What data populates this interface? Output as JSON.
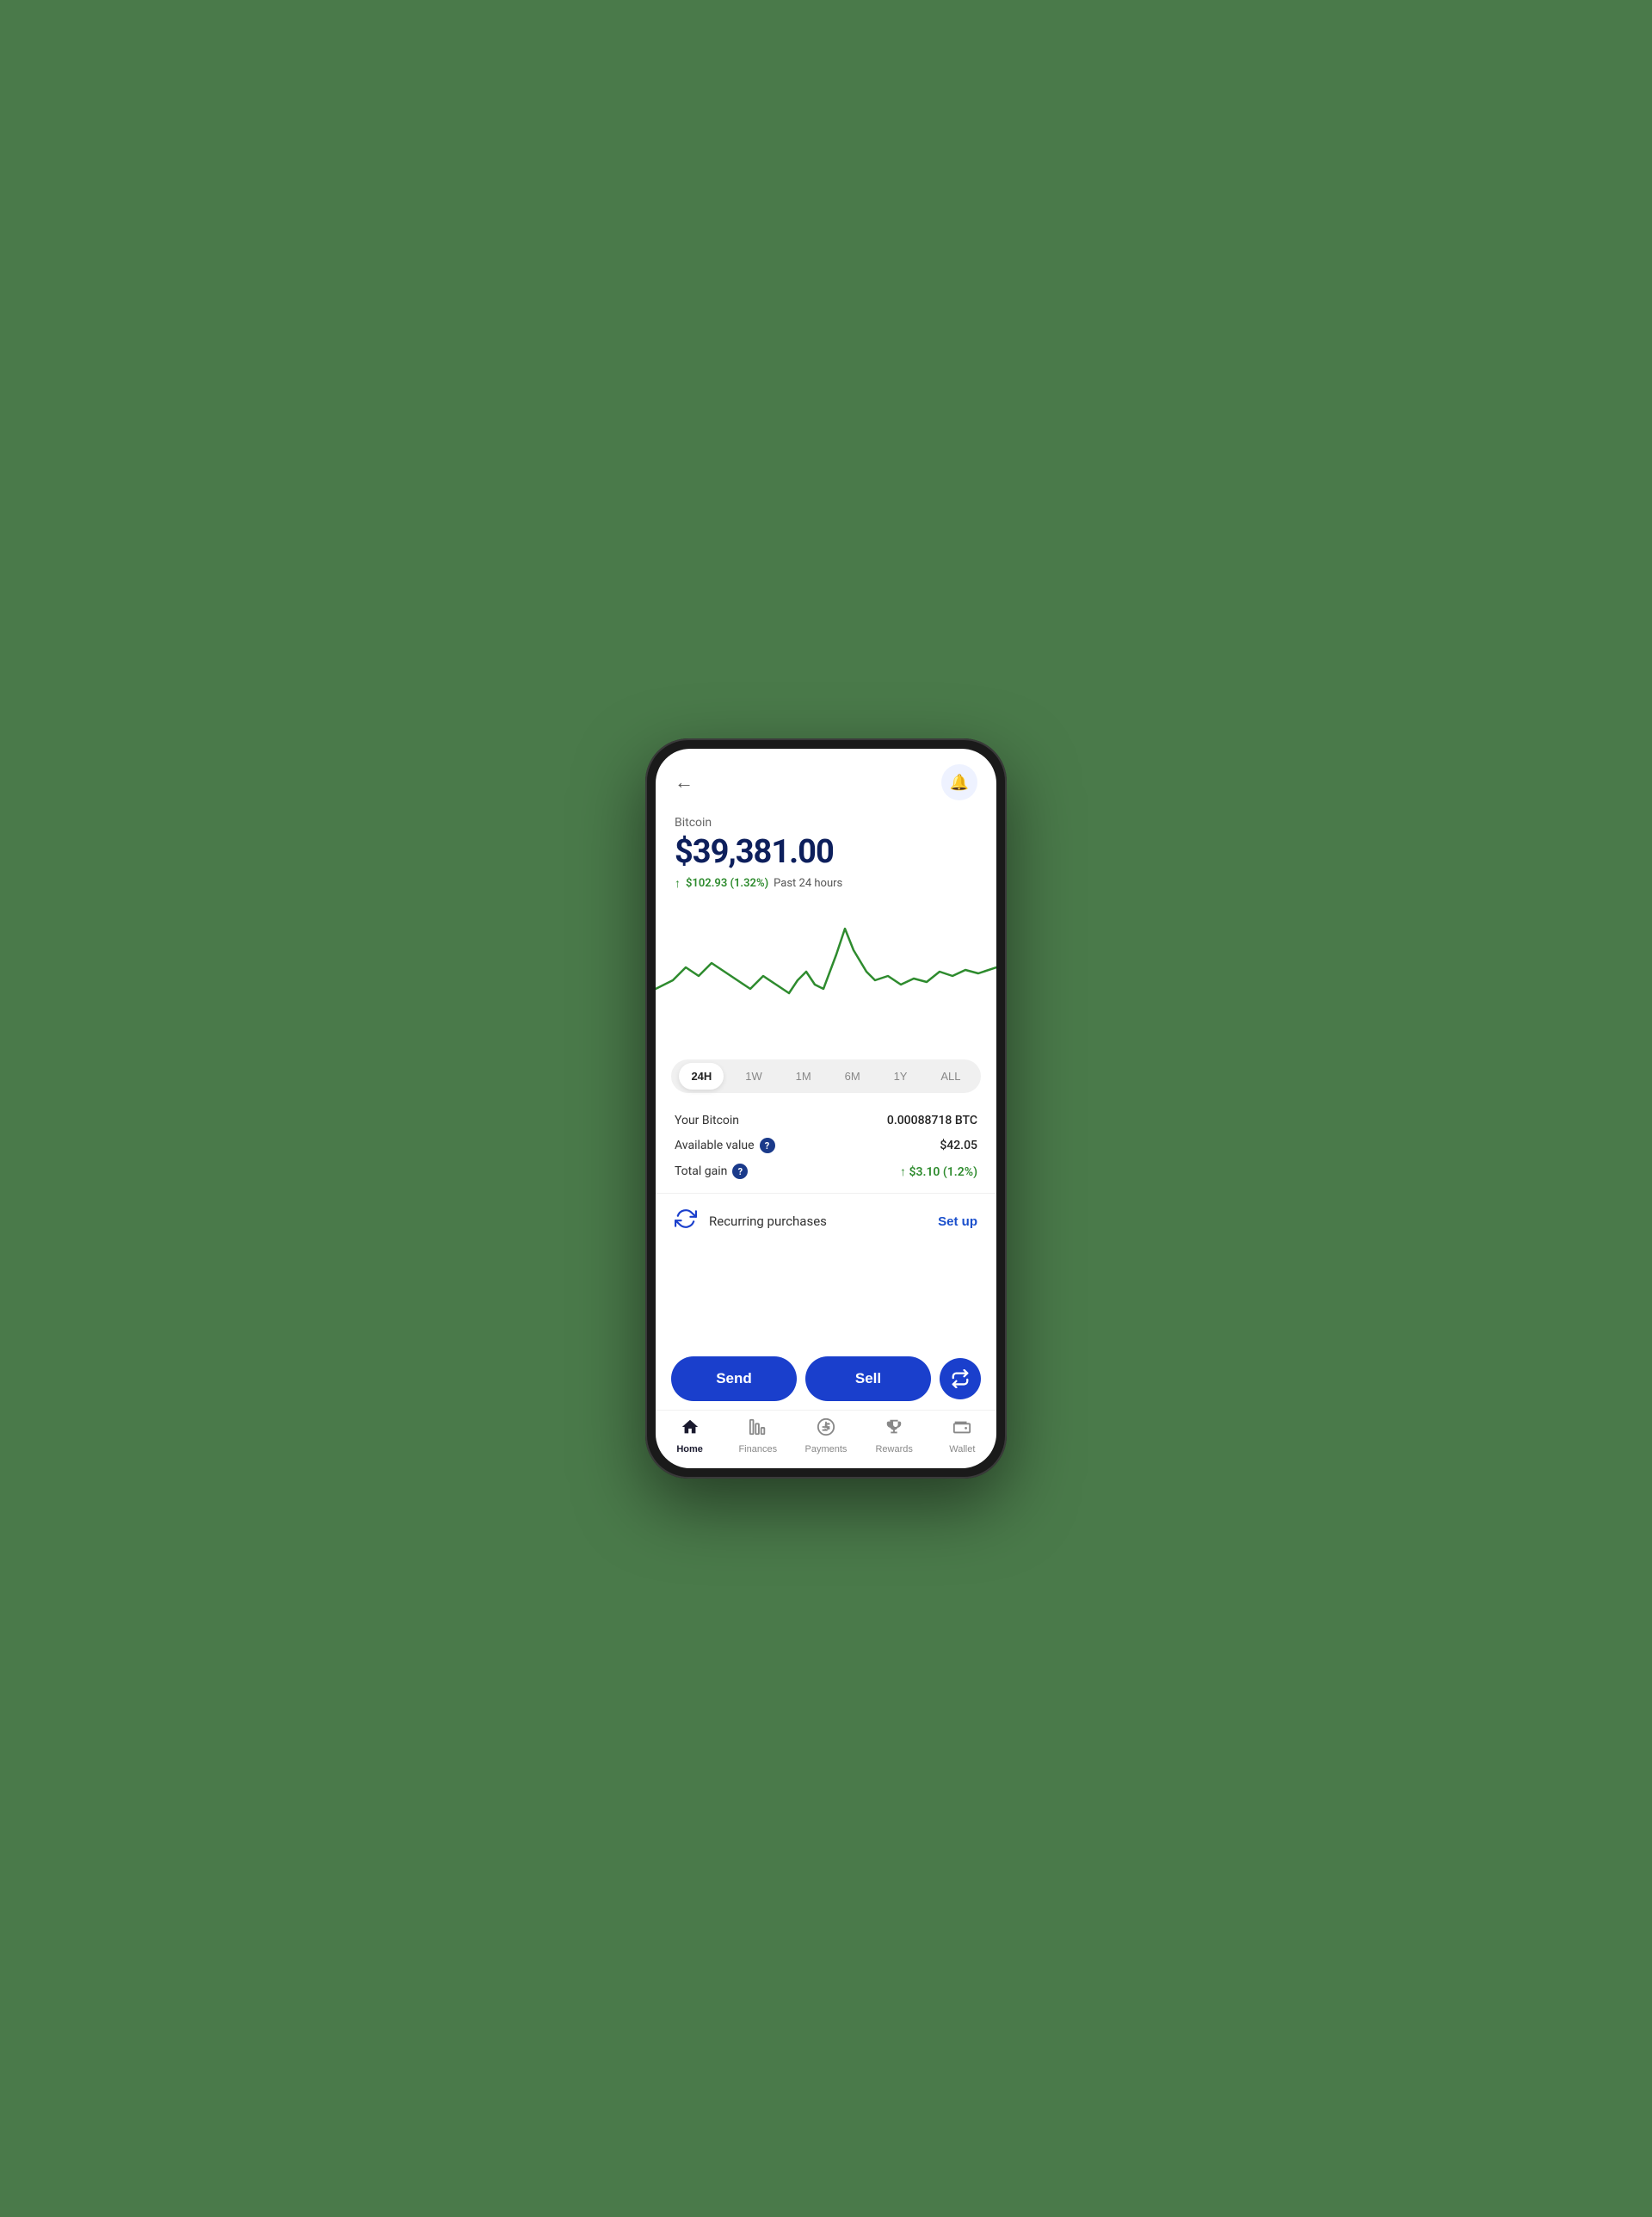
{
  "header": {
    "back_label": "←",
    "bell_icon": "🔔"
  },
  "coin": {
    "name": "Bitcoin",
    "price": "$39,381.00",
    "change_amount": "$102.93 (1.32%)",
    "change_period": "Past 24 hours"
  },
  "chart": {
    "time_options": [
      "24H",
      "1W",
      "1M",
      "6M",
      "1Y",
      "ALL"
    ],
    "active_time": "24H"
  },
  "stats": {
    "your_bitcoin_label": "Your Bitcoin",
    "your_bitcoin_value": "0.00088718 BTC",
    "available_value_label": "Available value",
    "available_value": "$42.05",
    "total_gain_label": "Total gain",
    "total_gain_value": "↑ $3.10 (1.2%)"
  },
  "recurring": {
    "label": "Recurring purchases",
    "setup_label": "Set up"
  },
  "actions": {
    "send_label": "Send",
    "sell_label": "Sell",
    "swap_icon": "⇄"
  },
  "nav": {
    "items": [
      {
        "id": "home",
        "label": "Home",
        "active": true
      },
      {
        "id": "finances",
        "label": "Finances",
        "active": false
      },
      {
        "id": "payments",
        "label": "Payments",
        "active": false
      },
      {
        "id": "rewards",
        "label": "Rewards",
        "active": false
      },
      {
        "id": "wallet",
        "label": "Wallet",
        "active": false
      }
    ]
  },
  "colors": {
    "primary": "#1a3fcc",
    "green": "#2e8b2e",
    "text_dark": "#0d1f5c"
  }
}
